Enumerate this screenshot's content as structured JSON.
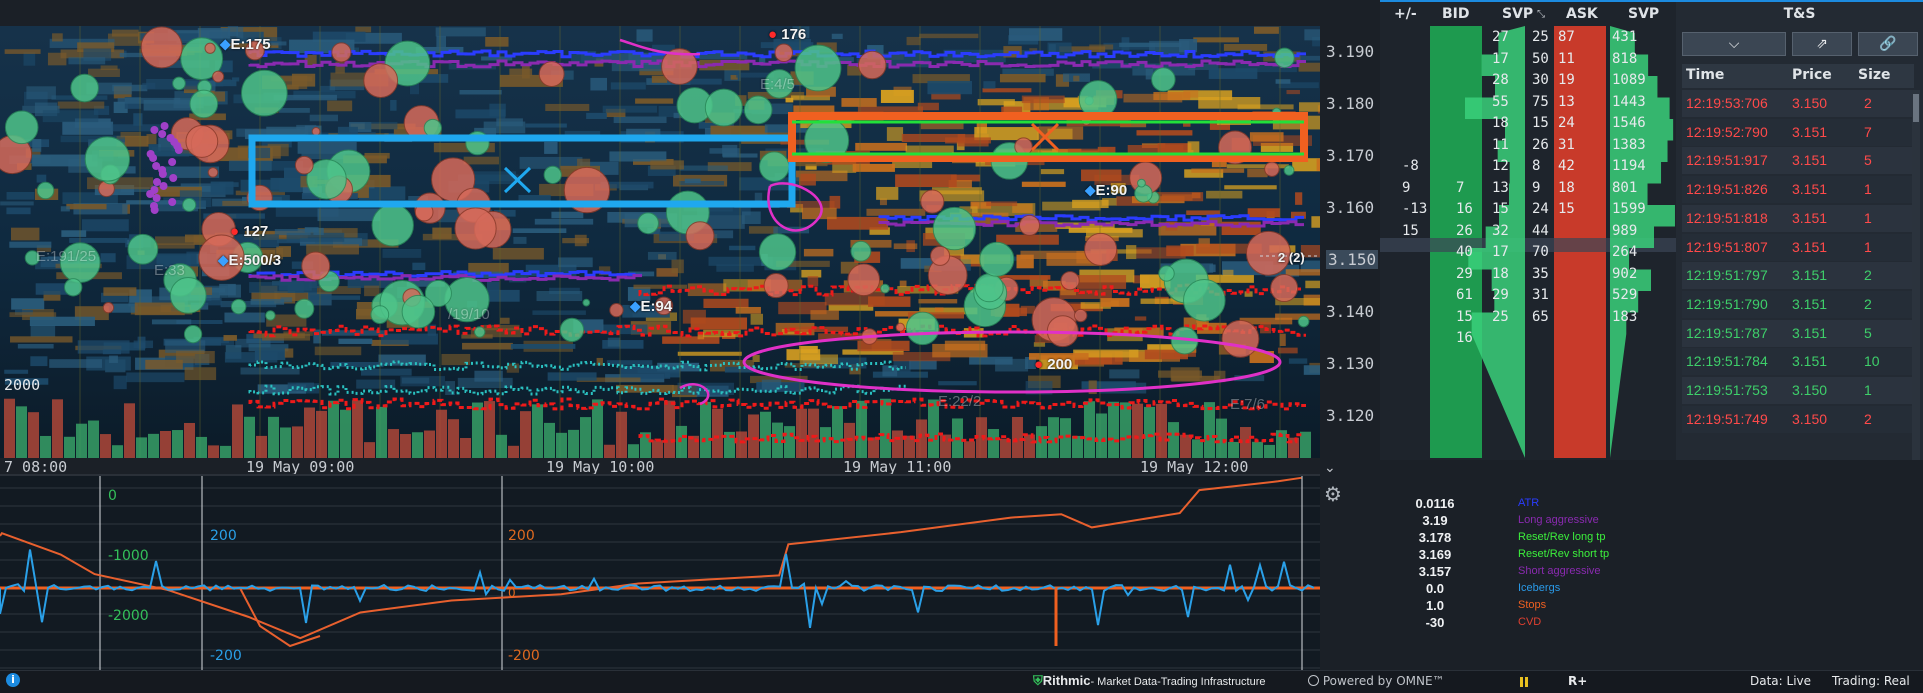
{
  "chart": {
    "price_ticks": [
      "3.190",
      "3.180",
      "3.170",
      "3.160",
      "3.150",
      "3.140",
      "3.130",
      "3.120"
    ],
    "time_labels": [
      "7 08:00",
      "19 May 09:00",
      "19 May 10:00",
      "19 May 11:00",
      "19 May 12:00"
    ],
    "volume_label": "2000",
    "tags": {
      "e175": "E:175",
      "n176": "176",
      "e90": "E:90",
      "n127": "127",
      "e500": "E:500/3",
      "e94": "E:94",
      "n200": "200",
      "cur": "2 (2)",
      "faint1": "E:191/25",
      "faint2": "E:33",
      "faint3": "/19/10",
      "faint4": "E:22/2",
      "faint5": "E:7/6",
      "faint6": "E:4/5"
    },
    "colors": {
      "bid": "#1e9a4f",
      "ask": "#c83a2a",
      "long": "#f06020",
      "short": "#1fa0e6",
      "magenta": "#e030c8"
    }
  },
  "ladder": {
    "headers": {
      "pm": "+/-",
      "bid": "BID",
      "svp1": "SVP",
      "ask": "ASK",
      "svp2": "SVP"
    },
    "pm_values": [
      {
        "row": 6,
        "text": "-8"
      },
      {
        "row": 7,
        "text": "9"
      },
      {
        "row": 8,
        "text": "-13"
      },
      {
        "row": 9,
        "text": "15"
      }
    ],
    "bid_sizes": [
      {
        "row": 7,
        "text": "7"
      },
      {
        "row": 8,
        "text": "16"
      },
      {
        "row": 9,
        "text": "26"
      },
      {
        "row": 10,
        "text": "40"
      },
      {
        "row": 11,
        "text": "29"
      },
      {
        "row": 12,
        "text": "61"
      },
      {
        "row": 13,
        "text": "15"
      },
      {
        "row": 14,
        "text": "16"
      }
    ],
    "svp1": [
      {
        "row": 0,
        "text": "27",
        "b": "25"
      },
      {
        "row": 1,
        "text": "17",
        "b": "50"
      },
      {
        "row": 2,
        "text": "28",
        "b": "30"
      },
      {
        "row": 3,
        "text": "55",
        "b": "75"
      },
      {
        "row": 4,
        "text": "18",
        "b": "15"
      },
      {
        "row": 5,
        "text": "11",
        "b": "26"
      },
      {
        "row": 6,
        "text": "12",
        "b": "8"
      },
      {
        "row": 7,
        "text": "13",
        "b": "9"
      },
      {
        "row": 8,
        "text": "15",
        "b": "24"
      },
      {
        "row": 9,
        "text": "32",
        "b": "44"
      },
      {
        "row": 10,
        "text": "17",
        "b": "70"
      },
      {
        "row": 11,
        "text": "18",
        "b": "35"
      },
      {
        "row": 12,
        "text": "29",
        "b": "31"
      },
      {
        "row": 13,
        "text": "25",
        "b": "65"
      }
    ],
    "ask_sizes": [
      {
        "row": 0,
        "text": "87"
      },
      {
        "row": 1,
        "text": "11"
      },
      {
        "row": 2,
        "text": "19"
      },
      {
        "row": 3,
        "text": "13"
      },
      {
        "row": 4,
        "text": "24"
      },
      {
        "row": 5,
        "text": "31"
      },
      {
        "row": 6,
        "text": "42"
      },
      {
        "row": 7,
        "text": "18"
      },
      {
        "row": 8,
        "text": "15"
      }
    ],
    "svp2": [
      {
        "row": 0,
        "text": "431"
      },
      {
        "row": 1,
        "text": "818"
      },
      {
        "row": 2,
        "text": "1089"
      },
      {
        "row": 3,
        "text": "1443"
      },
      {
        "row": 4,
        "text": "1546"
      },
      {
        "row": 5,
        "text": "1383"
      },
      {
        "row": 6,
        "text": "1194"
      },
      {
        "row": 7,
        "text": "801"
      },
      {
        "row": 8,
        "text": "1599"
      },
      {
        "row": 9,
        "text": "989"
      },
      {
        "row": 10,
        "text": "264"
      },
      {
        "row": 11,
        "text": "902"
      },
      {
        "row": 12,
        "text": "529"
      },
      {
        "row": 13,
        "text": "183"
      }
    ]
  },
  "ts": {
    "title": "T&S",
    "columns": {
      "time": "Time",
      "price": "Price",
      "size": "Size"
    },
    "rows": [
      {
        "time": "12:19:53:706",
        "price": "3.150",
        "size": "2",
        "side": "sell"
      },
      {
        "time": "12:19:52:790",
        "price": "3.151",
        "size": "7",
        "side": "sell"
      },
      {
        "time": "12:19:51:917",
        "price": "3.151",
        "size": "5",
        "side": "sell"
      },
      {
        "time": "12:19:51:826",
        "price": "3.151",
        "size": "1",
        "side": "sell"
      },
      {
        "time": "12:19:51:818",
        "price": "3.151",
        "size": "1",
        "side": "sell"
      },
      {
        "time": "12:19:51:807",
        "price": "3.151",
        "size": "1",
        "side": "sell"
      },
      {
        "time": "12:19:51:797",
        "price": "3.151",
        "size": "2",
        "side": "buy"
      },
      {
        "time": "12:19:51:790",
        "price": "3.151",
        "size": "2",
        "side": "buy"
      },
      {
        "time": "12:19:51:787",
        "price": "3.151",
        "size": "5",
        "side": "buy"
      },
      {
        "time": "12:19:51:784",
        "price": "3.151",
        "size": "10",
        "side": "buy"
      },
      {
        "time": "12:19:51:753",
        "price": "3.150",
        "size": "1",
        "side": "buy"
      },
      {
        "time": "12:19:51:749",
        "price": "3.150",
        "size": "2",
        "side": "sell"
      }
    ],
    "buy_color": "#3ecf6a",
    "sell_color": "#ff4a4a"
  },
  "indicator": {
    "labels": {
      "zero": "0",
      "m1000": "-1000",
      "m2000": "-2000",
      "p200a": "200",
      "m200a": "-200",
      "p200b": "200",
      "m200b": "-200",
      "zero_b": "0"
    }
  },
  "legend": {
    "items": [
      {
        "value": "0.0116",
        "name": "ATR",
        "color": "#2a3cff"
      },
      {
        "value": "3.19",
        "name": "Long aggressive",
        "color": "#8a2ab0"
      },
      {
        "value": "3.178",
        "name": "Reset/Rev long tp",
        "color": "#3cf03c"
      },
      {
        "value": "3.169",
        "name": "Reset/Rev short tp",
        "color": "#3cf03c"
      },
      {
        "value": "3.157",
        "name": "Short aggressive",
        "color": "#8a2ab0"
      },
      {
        "value": "0.0",
        "name": "Icebergs",
        "color": "#2a9ae8"
      },
      {
        "value": "1.0",
        "name": "Stops",
        "color": "#f06020"
      },
      {
        "value": "-30",
        "name": "CVD",
        "color": "#e04030"
      }
    ]
  },
  "status": {
    "brand": "Rithmic",
    "brand_sub": "- Market Data-Trading Infrastructure",
    "powered": "Powered by OMNE™",
    "rplus": "R+",
    "data": "Data: Live",
    "trading": "Trading: Real",
    "info": "i"
  }
}
